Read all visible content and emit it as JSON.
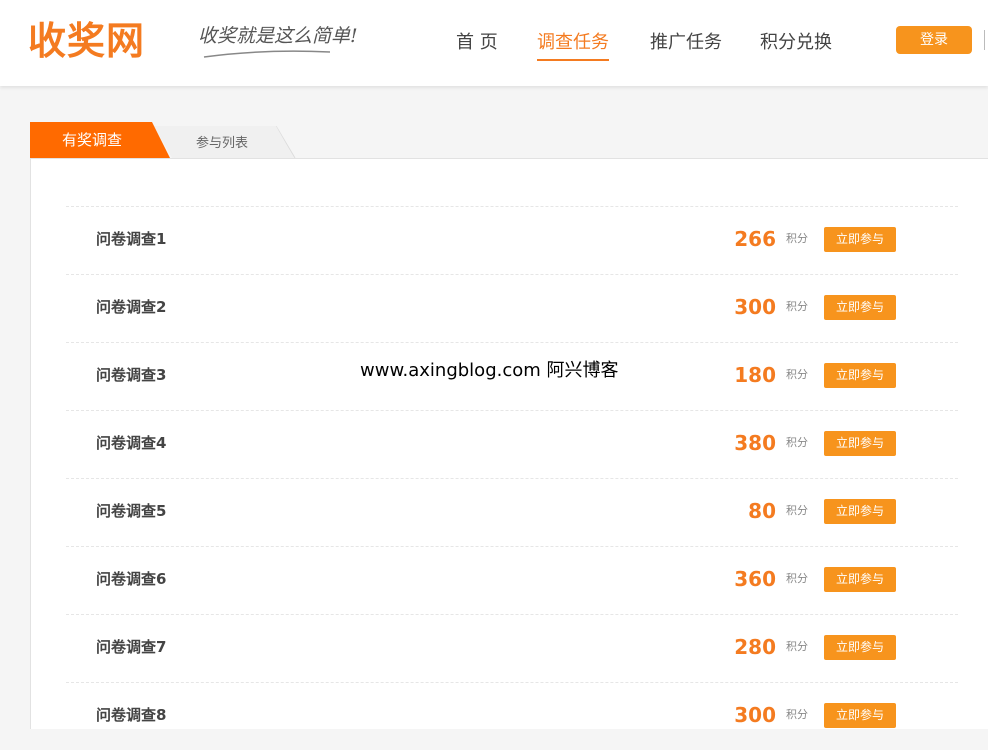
{
  "header": {
    "logo": "收奖网",
    "slogan": "收奖就是这么简单!",
    "nav": [
      "首 页",
      "调查任务",
      "推广任务",
      "积分兑换"
    ],
    "nav_active_index": 1,
    "login_label": "登录"
  },
  "tabs": {
    "active_label": "有奖调查",
    "inactive_label": "参与列表"
  },
  "survey": {
    "points_unit": "积分",
    "join_label": "立即参与",
    "items": [
      {
        "title": "问卷调查1",
        "points": "266"
      },
      {
        "title": "问卷调查2",
        "points": "300"
      },
      {
        "title": "问卷调查3",
        "points": "180"
      },
      {
        "title": "问卷调查4",
        "points": "380"
      },
      {
        "title": "问卷调查5",
        "points": "80"
      },
      {
        "title": "问卷调查6",
        "points": "360"
      },
      {
        "title": "问卷调查7",
        "points": "280"
      },
      {
        "title": "问卷调查8",
        "points": "300"
      }
    ]
  },
  "watermark": "www.axingblog.com 阿兴博客",
  "colors": {
    "accent": "#f47b20",
    "button": "#f7941d",
    "tab_active": "#ff6a00"
  }
}
